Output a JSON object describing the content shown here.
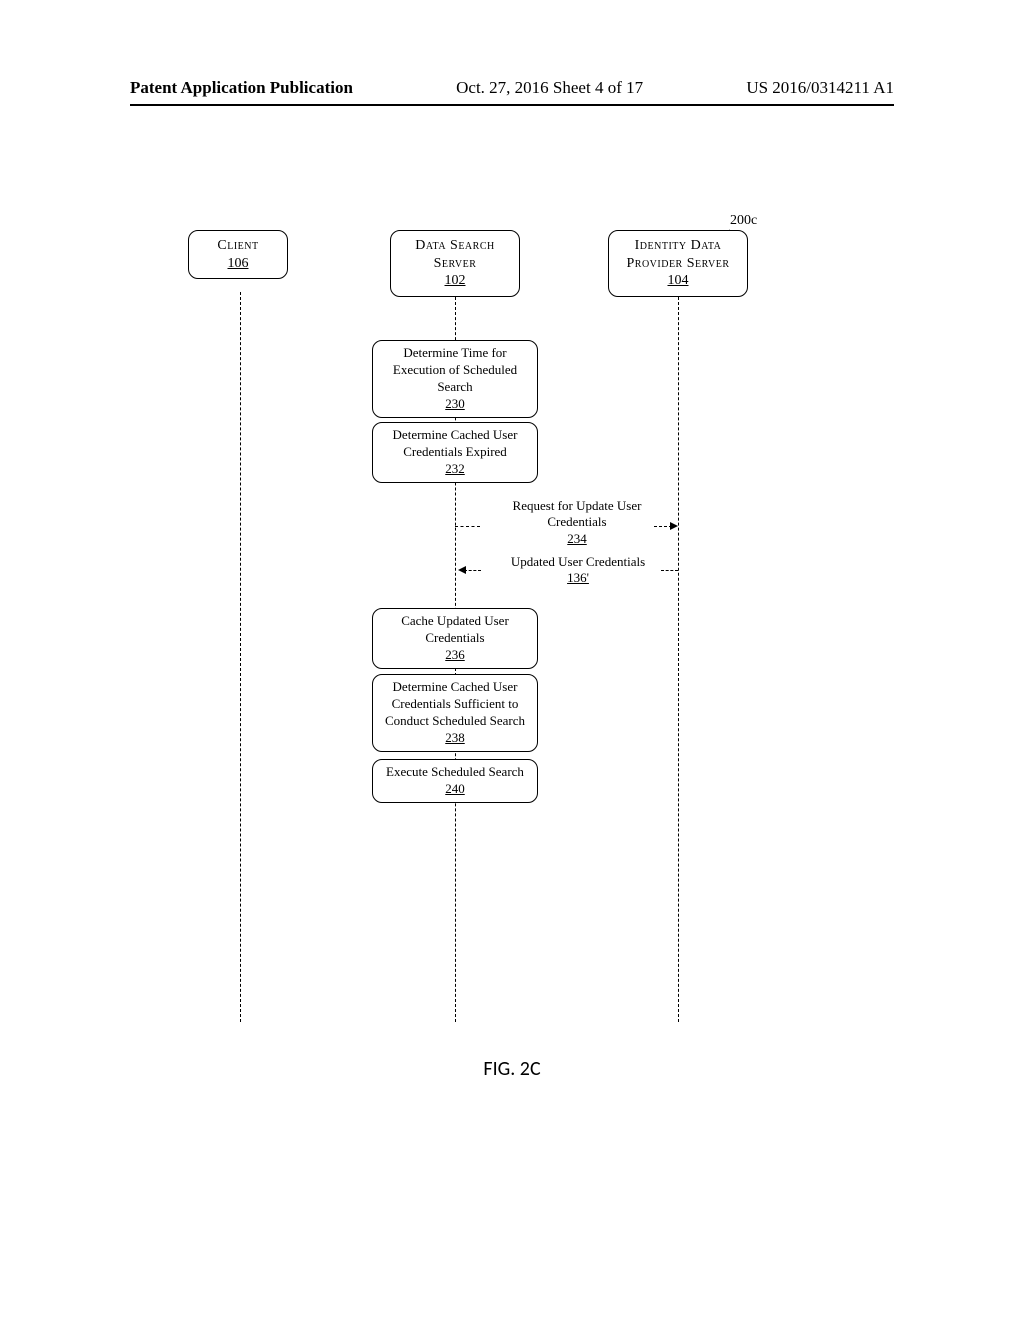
{
  "header": {
    "left": "Patent Application Publication",
    "center": "Oct. 27, 2016   Sheet 4 of 17",
    "right": "US 2016/0314211 A1"
  },
  "figure_label": "FIG. 2C",
  "figure_ref": "200c",
  "participants": {
    "client": {
      "name": "Client",
      "ref": "106"
    },
    "search": {
      "name": "Data Search Server",
      "ref": "102"
    },
    "ident": {
      "name": "Identity Data Provider Server",
      "ref": "104"
    }
  },
  "steps": {
    "determine_time": {
      "text": "Determine Time for Execution of Scheduled Search",
      "ref": "230"
    },
    "determine_expired": {
      "text": "Determine Cached User Credentials Expired",
      "ref": "232"
    },
    "cache_updated": {
      "text": "Cache Updated User Credentials",
      "ref": "236"
    },
    "determine_suff": {
      "text": "Determine Cached User Credentials Sufficient to Conduct Scheduled Search",
      "ref": "238"
    },
    "execute": {
      "text": "Execute Scheduled Search",
      "ref": "240"
    }
  },
  "messages": {
    "request_update": {
      "text": "Request for Update User Credentials",
      "ref": "234"
    },
    "updated_creds": {
      "text": "Updated User Credentials",
      "ref": "136'"
    }
  }
}
